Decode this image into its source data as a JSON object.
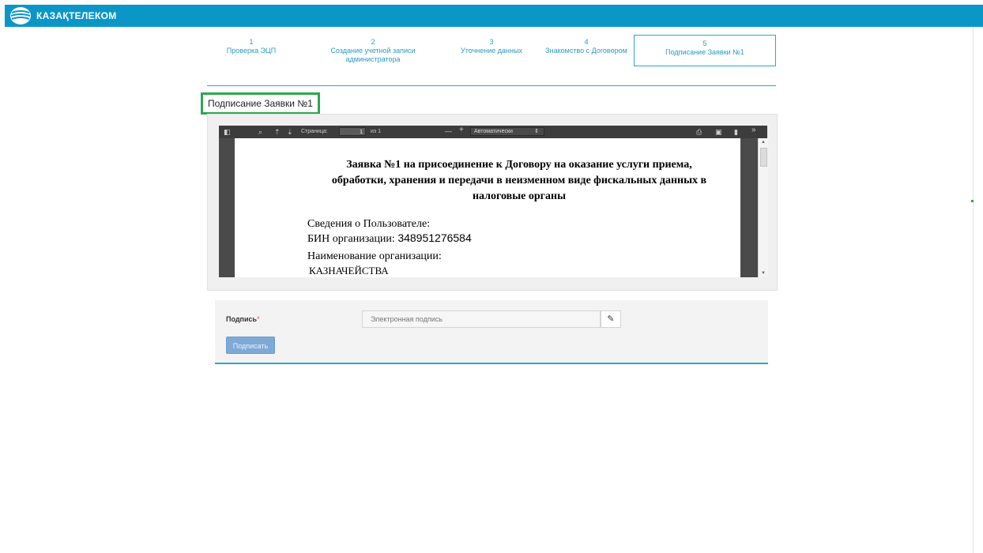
{
  "header": {
    "brand_name": "КАЗАҚТЕЛЕКОМ",
    "brand_color": "#0b96c8"
  },
  "steps": [
    {
      "number": "1",
      "label": "Проверка ЭЦП",
      "active": false
    },
    {
      "number": "2",
      "label": "Создание учетной записи администратора",
      "active": false
    },
    {
      "number": "3",
      "label": "Уточнение данных",
      "active": false
    },
    {
      "number": "4",
      "label": "Знакомство с Договором",
      "active": false
    },
    {
      "number": "5",
      "label": "Подписание Заявки №1",
      "active": true
    }
  ],
  "section": {
    "title": "Подписание Заявки №1",
    "highlight_color": "#2fa84f"
  },
  "pdf_viewer": {
    "page_label": "Страница:",
    "page_current": "1",
    "page_total": "из 1",
    "zoom_value": "Автоматически",
    "zoom_minus": "—",
    "zoom_plus": "+",
    "icons": [
      "sidebar-toggle-icon",
      "search-icon",
      "prev-page-icon",
      "next-page-icon",
      "print-icon",
      "download-icon",
      "bookmark-icon",
      "tools-icon"
    ]
  },
  "document": {
    "title_line1": "Заявка №1 на присоединение к Договору на оказание услуги приема,",
    "title_line2": "обработки, хранения и передачи в неизменном виде фискальных данных в",
    "title_line3": "налоговые органы",
    "user_info_label": "Сведения о Пользователе:",
    "bin_label": "БИН организации:",
    "bin_value": "348951276584",
    "org_name_label": "Наименование организации:",
    "org_name_value": "КАЗНАЧЕЙСТВА"
  },
  "signature": {
    "label": "Подпись",
    "required_mark": "*",
    "input_placeholder": "Электронная подпись",
    "sign_button": "Подписать"
  }
}
